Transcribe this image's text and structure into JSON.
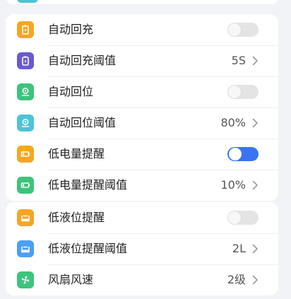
{
  "colors": {
    "page_background": "#f2f3f7",
    "card_background": "#ffffff",
    "toggle_on": "#3a74f2",
    "toggle_off": "#e4e4e4",
    "orange": "#f5a623",
    "purple": "#6a5acd",
    "green": "#3cc47c",
    "cyan": "#4ec3d7",
    "blue": "#4d9ef4"
  },
  "card1": {
    "rows": [
      {
        "label": "自动回充",
        "control": "toggle",
        "on": false,
        "icon": "battery-charge-icon",
        "icon_color": "#f5a623"
      },
      {
        "label": "自动回充阈值",
        "value": "5S",
        "control": "chevron",
        "icon": "battery-charge-threshold-icon",
        "icon_color": "#6a5acd"
      },
      {
        "label": "自动回位",
        "control": "toggle",
        "on": false,
        "icon": "location-pin-icon",
        "icon_color": "#3cc47c"
      },
      {
        "label": "自动回位阈值",
        "value": "80%",
        "control": "chevron",
        "icon": "location-pin-threshold-icon",
        "icon_color": "#4ec3d7"
      },
      {
        "label": "低电量提醒",
        "control": "toggle",
        "on": true,
        "icon": "low-battery-icon",
        "icon_color": "#f5a623"
      },
      {
        "label": "低电量提醒阈值",
        "value": "10%",
        "control": "chevron",
        "icon": "low-battery-threshold-icon",
        "icon_color": "#3cc47c"
      }
    ]
  },
  "card2": {
    "rows": [
      {
        "label": "低液位提醒",
        "control": "toggle",
        "on": false,
        "icon": "liquid-tank-icon",
        "icon_color": "#f5a623"
      },
      {
        "label": "低液位提醒阈值",
        "value": "2L",
        "control": "chevron",
        "icon": "liquid-tank-threshold-icon",
        "icon_color": "#4d9ef4"
      },
      {
        "label": "风扇风速",
        "value": "2级",
        "control": "chevron",
        "icon": "fan-icon",
        "icon_color": "#3cc47c"
      }
    ]
  }
}
